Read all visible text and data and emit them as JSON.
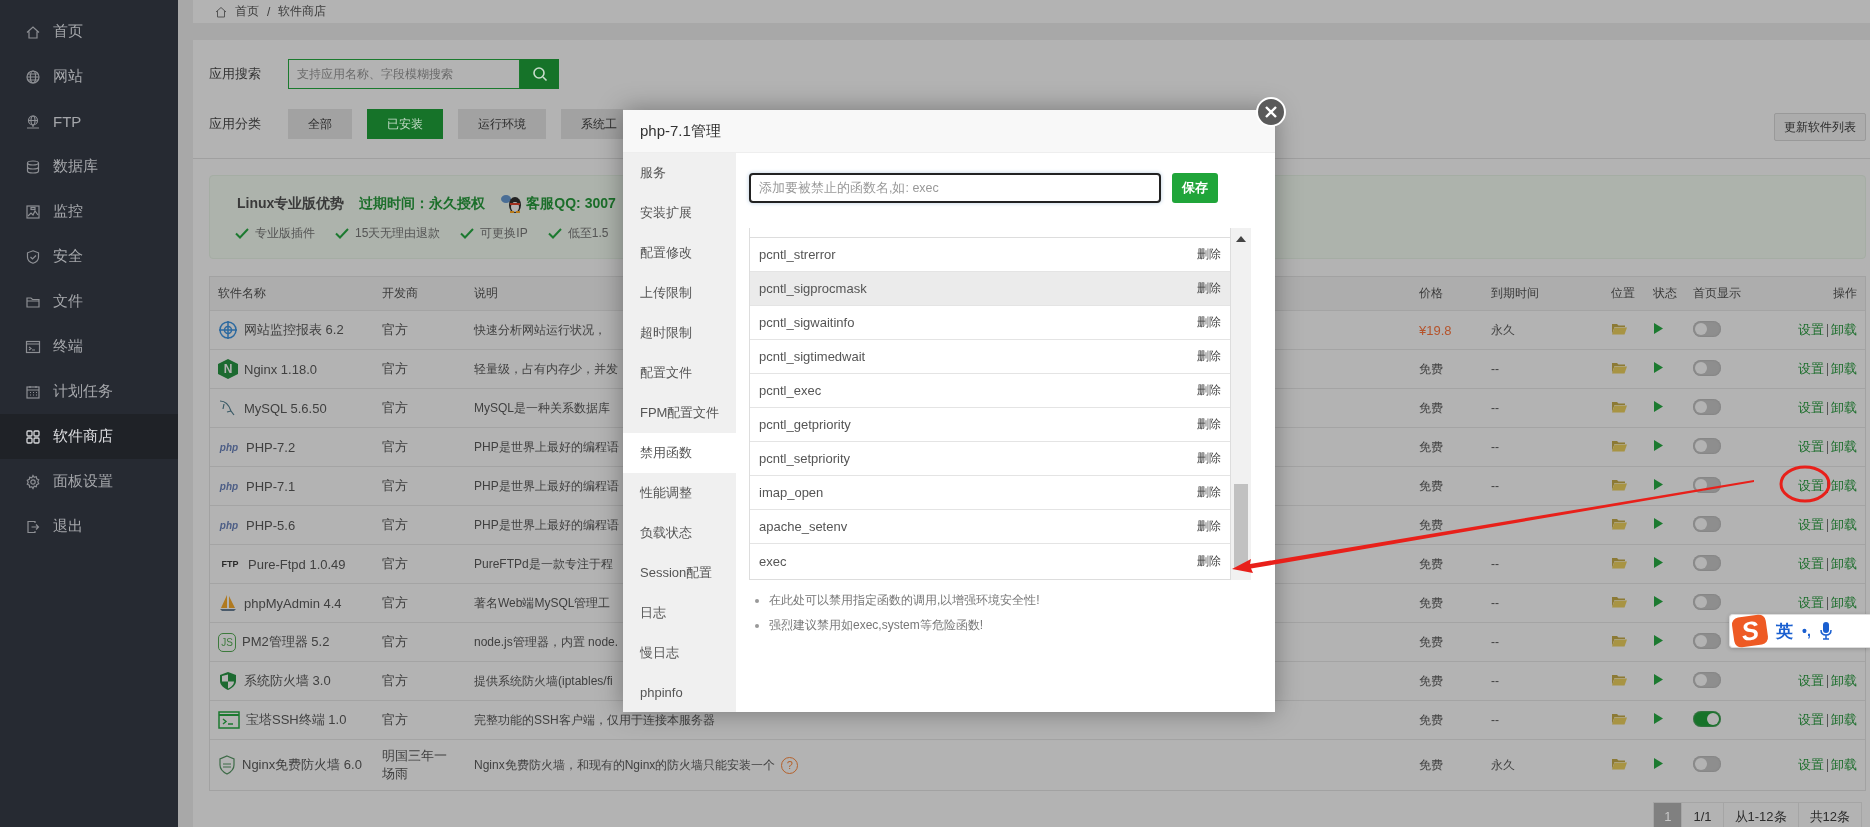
{
  "sidebar": {
    "items": [
      {
        "label": "首页",
        "selected": false
      },
      {
        "label": "网站",
        "selected": false
      },
      {
        "label": "FTP",
        "selected": false
      },
      {
        "label": "数据库",
        "selected": false
      },
      {
        "label": "监控",
        "selected": false
      },
      {
        "label": "安全",
        "selected": false
      },
      {
        "label": "文件",
        "selected": false
      },
      {
        "label": "终端",
        "selected": false
      },
      {
        "label": "计划任务",
        "selected": false
      },
      {
        "label": "软件商店",
        "selected": true
      },
      {
        "label": "面板设置",
        "selected": false
      },
      {
        "label": "退出",
        "selected": false
      }
    ]
  },
  "breadcrumb": {
    "items": [
      "首页",
      "软件商店"
    ],
    "separator": "/"
  },
  "search": {
    "label": "应用搜索",
    "placeholder": "支持应用名称、字段模糊搜索"
  },
  "categories": {
    "label": "应用分类",
    "items": [
      {
        "label": "全部",
        "selected": false
      },
      {
        "label": "已安装",
        "selected": true
      },
      {
        "label": "运行环境",
        "selected": false
      },
      {
        "label": "系统工",
        "selected": false
      }
    ]
  },
  "update_button": "更新软件列表",
  "promo": {
    "title": "Linux专业版优势",
    "expiry": "过期时间：永久授权",
    "qq": "客服QQ: 3007",
    "features": [
      "专业版插件",
      "15天无理由退款",
      "可更换IP",
      "低至1.5"
    ]
  },
  "table": {
    "columns": [
      "软件名称",
      "开发商",
      "说明",
      "价格",
      "到期时间",
      "位置",
      "状态",
      "首页显示",
      "操作"
    ],
    "rows": [
      {
        "name": "网站监控报表 6.2",
        "developer": "官方",
        "description": "快速分析网站运行状况，",
        "price": "¥19.8",
        "paid": true,
        "expiry": "永久",
        "home_display": false,
        "actions": [
          "设置",
          "卸载"
        ]
      },
      {
        "name": "Nginx 1.18.0",
        "logo_text": "N",
        "developer": "官方",
        "description": "轻量级，占有内存少，并发",
        "price": "免费",
        "paid": false,
        "expiry": "--",
        "home_display": false,
        "actions": [
          "设置",
          "卸载"
        ]
      },
      {
        "name": "MySQL 5.6.50",
        "developer": "官方",
        "description": "MySQL是一种关系数据库",
        "price": "免费",
        "paid": false,
        "expiry": "--",
        "home_display": false,
        "actions": [
          "设置",
          "卸载"
        ]
      },
      {
        "name": "PHP-7.2",
        "logo_text": "php",
        "developer": "官方",
        "description": "PHP是世界上最好的编程语",
        "price": "免费",
        "paid": false,
        "expiry": "--",
        "home_display": false,
        "actions": [
          "设置",
          "卸载"
        ]
      },
      {
        "name": "PHP-7.1",
        "logo_text": "php",
        "developer": "官方",
        "description": "PHP是世界上最好的编程语",
        "price": "免费",
        "paid": false,
        "expiry": "--",
        "home_display": false,
        "actions": [
          "设置",
          "卸载"
        ]
      },
      {
        "name": "PHP-5.6",
        "logo_text": "php",
        "developer": "官方",
        "description": "PHP是世界上最好的编程语",
        "price": "免费",
        "paid": false,
        "home_display": false,
        "actions": [
          "设置",
          "卸载"
        ]
      },
      {
        "name": "Pure-Ftpd 1.0.49",
        "logo_text": "FTP",
        "developer": "官方",
        "description": "PureFTPd是一款专注于程",
        "price": "免费",
        "paid": false,
        "expiry": "--",
        "home_display": false,
        "actions": [
          "设置",
          "卸载"
        ]
      },
      {
        "name": "phpMyAdmin 4.4",
        "developer": "官方",
        "description": "著名Web端MySQL管理工",
        "price": "免费",
        "paid": false,
        "expiry": "--",
        "home_display": false,
        "actions": [
          "设置",
          "卸载"
        ]
      },
      {
        "name": "PM2管理器 5.2",
        "logo_text": "JS",
        "developer": "官方",
        "description": "node.js管理器，内置 node.",
        "price": "免费",
        "paid": false,
        "expiry": "--",
        "home_display": false
      },
      {
        "name": "系统防火墙 3.0",
        "developer": "官方",
        "description": "提供系统防火墙(iptables/fi",
        "price": "免费",
        "paid": false,
        "expiry": "--",
        "home_display": false,
        "actions": [
          "设置",
          "卸载"
        ]
      },
      {
        "name": "宝塔SSH终端 1.0",
        "developer": "官方",
        "description": "完整功能的SSH客户端，仅用于连接本服务器",
        "price": "免费",
        "paid": false,
        "expiry": "--",
        "home_display": true,
        "actions": [
          "设置",
          "卸载"
        ]
      },
      {
        "name": "Nginx免费防火墙 6.0",
        "developer": "明国三年一场雨",
        "description": "Nginx免费防火墙，和现有的Nginx的防火墙只能安装一个",
        "help": "?",
        "price": "免费",
        "paid": false,
        "expiry": "永久",
        "home_display": false,
        "actions": [
          "设置",
          "卸载"
        ]
      }
    ]
  },
  "pagination": {
    "pages": [
      {
        "label": "1",
        "selected": true
      }
    ],
    "info": [
      "1/1",
      "从1-12条",
      "共12条"
    ]
  },
  "modal": {
    "title": "php-7.1管理",
    "nav": [
      {
        "label": "服务",
        "selected": false
      },
      {
        "label": "安装扩展",
        "selected": false
      },
      {
        "label": "配置修改",
        "selected": false
      },
      {
        "label": "上传限制",
        "selected": false
      },
      {
        "label": "超时限制",
        "selected": false
      },
      {
        "label": "配置文件",
        "selected": false
      },
      {
        "label": "FPM配置文件",
        "selected": false
      },
      {
        "label": "禁用函数",
        "selected": true
      },
      {
        "label": "性能调整",
        "selected": false
      },
      {
        "label": "负载状态",
        "selected": false
      },
      {
        "label": "Session配置",
        "selected": false
      },
      {
        "label": "日志",
        "selected": false
      },
      {
        "label": "慢日志",
        "selected": false
      },
      {
        "label": "phpinfo",
        "selected": false
      }
    ],
    "input": {
      "placeholder": "添加要被禁止的函数名,如: exec"
    },
    "save_button": "保存",
    "functions": [
      {
        "name": "pcntl_strerror",
        "action": "删除",
        "highlighted": false
      },
      {
        "name": "pcntl_sigprocmask",
        "action": "删除",
        "highlighted": true
      },
      {
        "name": "pcntl_sigwaitinfo",
        "action": "删除",
        "highlighted": false
      },
      {
        "name": "pcntl_sigtimedwait",
        "action": "删除",
        "highlighted": false
      },
      {
        "name": "pcntl_exec",
        "action": "删除",
        "highlighted": false
      },
      {
        "name": "pcntl_getpriority",
        "action": "删除",
        "highlighted": false
      },
      {
        "name": "pcntl_setpriority",
        "action": "删除",
        "highlighted": false
      },
      {
        "name": "imap_open",
        "action": "删除",
        "highlighted": false
      },
      {
        "name": "apache_setenv",
        "action": "删除",
        "highlighted": false
      },
      {
        "name": "exec",
        "action": "删除",
        "highlighted": false
      }
    ],
    "notes": [
      "在此处可以禁用指定函数的调用,以增强环境安全性!",
      "强烈建议禁用如exec,system等危险函数!"
    ]
  },
  "ime": {
    "logo": "S",
    "mode": "英",
    "punctuation": "•,"
  }
}
